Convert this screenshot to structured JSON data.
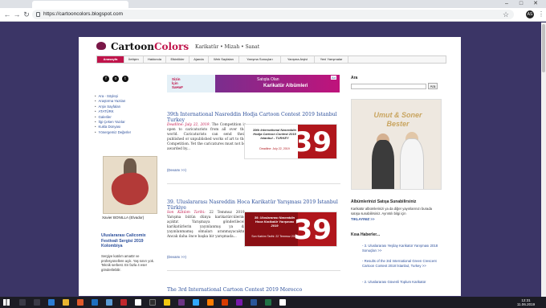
{
  "browser": {
    "url": "https://cartooncolors.blogspot.com",
    "profile_initial": "AS"
  },
  "header": {
    "logo_main": "Cartoon",
    "logo_accent": "Colors",
    "tagline": "Karikatür • Mizah • Sanat"
  },
  "nav": {
    "items": [
      "Anasayfa",
      "İletişim",
      "Hakkında",
      "Etkinlikler",
      "Ajanda",
      "Web Sayfaları",
      "Yarışma Sonuçları",
      "Yarışma Arşivi",
      "Yeni Yarışmalar"
    ]
  },
  "left_sidebar": {
    "social": [
      "f",
      "o",
      "t"
    ],
    "links": [
      "Ara - Söyleşi",
      "Araştırma Yazıları",
      "Arşiv Sayfaları",
      "ATATÜRK",
      "Galeriler",
      "İlgi Çeken Yazılar",
      "Kukla Dünyası",
      "Yönergemiz Değerler"
    ],
    "image_caption": "Xavier BONILLA (Elvador)",
    "heading": "Uluslararası Calicomix Festivali Sergisi 2019 Kolombiya",
    "text": "Sergiye katılım amatör ve profesyonellere açık. Yaş sınırı yok. Teknik serbest. En fazla 4 eser gönderilebilir."
  },
  "banner": {
    "left_line1": "Sizin",
    "left_line2": "İçin",
    "left_line3": "SaHaF",
    "mid": "Satışta Olan",
    "title": "Karikatür  Albümleri",
    "ad_tag": "Ad"
  },
  "posts": [
    {
      "title": "39th International Nasreddin Hodja Cartoon Contest 2019 Istanbul Turkey",
      "deadline_label": "Deadline: July 22, 2019.",
      "body": "The Competition is open to caricaturists from all over the world. Caricaturists can send their published or unpublished works of art to the Competition. Yet the caricatures must not be awarded by...",
      "more": "(Devamı >>)",
      "thumb_title": "39th International Nasreddin Hodja Cartoon Contest 2019 Istanbul - TURKEY",
      "thumb_sub": "Deadline: July 22, 2019",
      "thumb_number": "39"
    },
    {
      "title": "39. Uluslararası Nasreddin Hoca Karikatür Yarışması 2019 İstanbul Türkiye",
      "deadline_label": "Son Katılım Tarihi:",
      "body": "22 Temmuz 2019. Yarışma bütün dünya karikatürcülerine açıktır. Yarışmaya gönderilecek karikatürlerin yayınlanmış ya da yayınlanmamış olmaları aranmayacaktır. Ancak daha önce başka bir yarışmada...",
      "more": "(Devamı >>)",
      "thumb_title": "39. Uluslararası Nasreddin Hoca Karikatür Yarışması 2019",
      "thumb_sub": "Son Katılım Tarihi: 22 Temmuz 2019",
      "thumb_number": "39"
    },
    {
      "title": "The 3rd International Cartoon Contest 2019 Morocco"
    }
  ],
  "right_sidebar": {
    "search_heading": "Ara",
    "search_button": "Ara",
    "poster_name": "Umut & Soner Bester",
    "ad_heading": "Albümlerinizi Satışa Sunabilirsiniz",
    "ad_text": "Karikatür albümlerinizi ya da diğer yayınlarınızı burada satışa sunabilirsiniz. Ayrıntılı bilgi için",
    "ad_link": "TIKLAYINIZ >>",
    "news_heading": "Kısa Haberler...",
    "news": [
      "- 3. Uluslararası Yeşilay Karikatür Yarışması 2018 Sonuçları >>",
      "- Results of the 3rd International Green Crescent Cartoon Contest 2018 İstanbul, Turkey >>",
      "- 2. Uluslararası Güvenli Toplum Karikatür"
    ]
  },
  "taskbar": {
    "time": "12:31",
    "date": "11.06.2019"
  },
  "colors": {
    "accent": "#c0134a",
    "link": "#2c4f9b",
    "background": "#3b3566"
  }
}
